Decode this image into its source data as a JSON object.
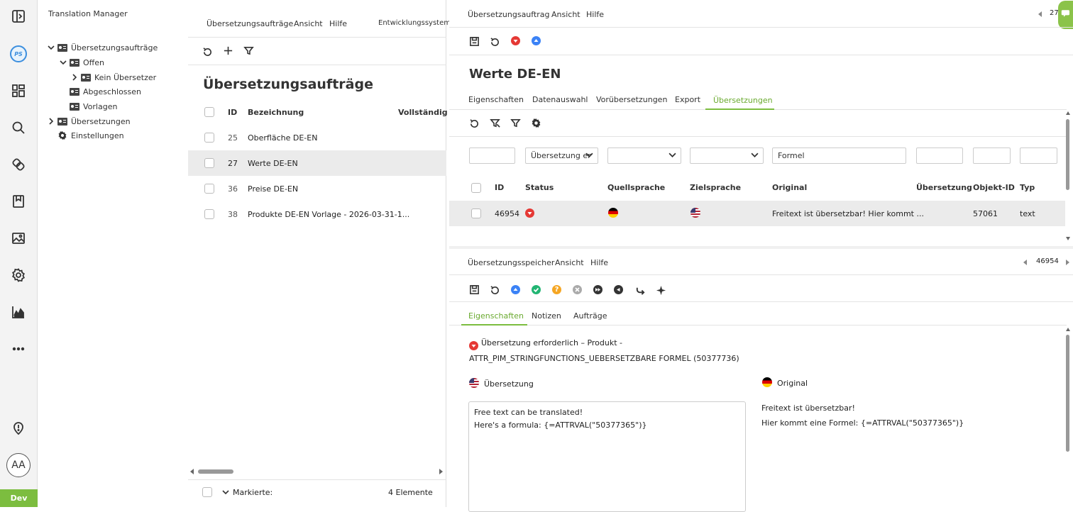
{
  "rail": {
    "items": [
      "sidebar-toggle-icon",
      "ps-logo",
      "dashboard-icon",
      "search-icon",
      "link-icon",
      "bookmark-icon",
      "image-icon",
      "settings-icon",
      "chart-icon",
      "more-icon",
      "location-icon"
    ],
    "avatar": "AA",
    "env_badge": "Dev"
  },
  "tree": {
    "title": "Translation Manager",
    "items": {
      "orders": "Übersetzungsaufträge",
      "open": "Offen",
      "no_translator": "Kein Übersetzer",
      "completed": "Abgeschlossen",
      "templates": "Vorlagen",
      "translations": "Übersetzungen",
      "settings": "Einstellungen"
    }
  },
  "list": {
    "menu": [
      "Übersetzungsaufträge",
      "Ansicht",
      "Hilfe"
    ],
    "system": "Entwicklungssystem",
    "heading": "Übersetzungsaufträge",
    "columns": {
      "id": "ID",
      "name": "Bezeichnung",
      "complete": "Vollständig"
    },
    "rows": [
      {
        "id": "25",
        "name": "Oberfläche DE-EN"
      },
      {
        "id": "27",
        "name": "Werte DE-EN"
      },
      {
        "id": "36",
        "name": "Preise DE-EN"
      },
      {
        "id": "38",
        "name": "Produkte DE-EN Vorlage - 2026-03-31-1..."
      }
    ],
    "footer_label": "Markierte:",
    "footer_count": "4 Elemente"
  },
  "detail": {
    "menu": [
      "Übersetzungsauftrag",
      "Ansicht",
      "Hilfe"
    ],
    "nav_number": "27",
    "title": "Werte DE-EN",
    "tabs": [
      "Eigenschaften",
      "Datenauswahl",
      "Vorübersetzungen",
      "Export",
      "Übersetzungen"
    ],
    "active_tab": "Übersetzungen",
    "filters": {
      "status": "Übersetzung er",
      "original": "Formel"
    },
    "columns": {
      "id": "ID",
      "status": "Status",
      "src": "Quellsprache",
      "tgt": "Zielsprache",
      "orig": "Original",
      "trans": "Übersetzung",
      "objid": "Objekt-ID",
      "type": "Typ"
    },
    "row": {
      "id": "46954",
      "original": "Freitext ist übersetzbar! Hier kommt ...",
      "object_id": "57061",
      "type": "text"
    }
  },
  "memory": {
    "menu": [
      "Übersetzungsspeicher",
      "Ansicht",
      "Hilfe"
    ],
    "nav_number": "46954",
    "tabs": [
      "Eigenschaften",
      "Notizen",
      "Aufträge"
    ],
    "active_tab": "Eigenschaften",
    "status_line1": "Übersetzung erforderlich – Produkt -",
    "status_line2": "ATTR_PIM_STRINGFUNCTIONS_UEBERSETZBARE FORMEL (50377736)",
    "translation_label": "Übersetzung",
    "original_label": "Original",
    "translation_line1": "Free text can be translated!",
    "translation_line2": "Here's a formula: {=ATTRVAL(\"50377365\")}",
    "original_line1": "Freitext ist übersetzbar!",
    "original_line2": "Hier kommt eine Formel: {=ATTRVAL(\"50377365\")}"
  },
  "colors": {
    "accent": "#7cbd3f",
    "status_red": "#e53935",
    "blue": "#3b82f6",
    "green": "#22b573",
    "orange": "#f5a623"
  }
}
